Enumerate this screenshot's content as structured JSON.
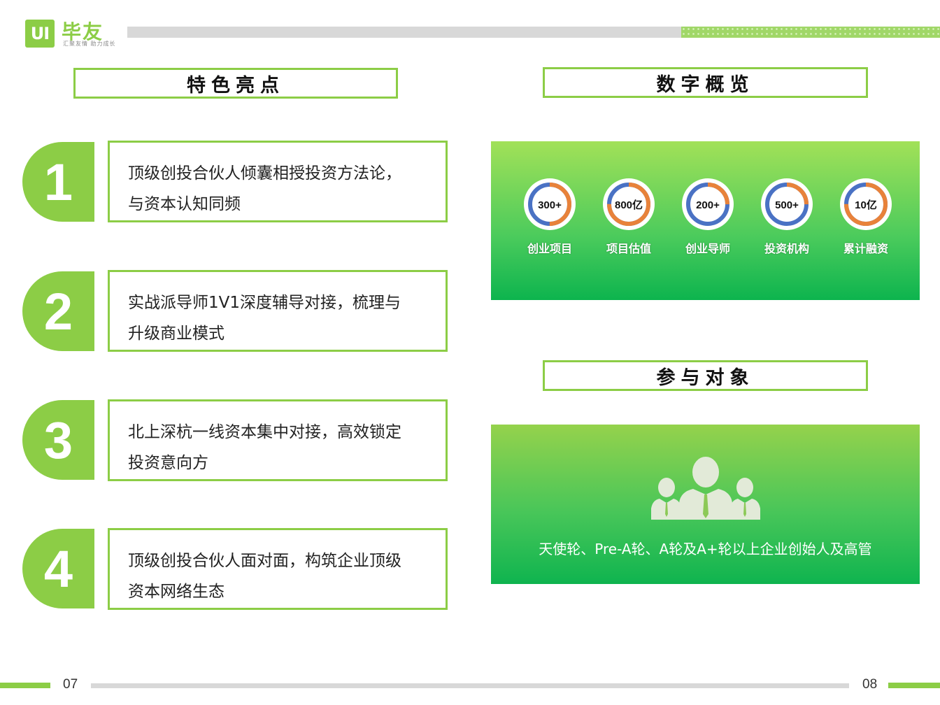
{
  "header": {
    "logo_mark": "UI",
    "logo_name": "毕友",
    "logo_tagline": "汇聚友情 助力成长"
  },
  "sections": {
    "features_title": "特色亮点",
    "stats_title": "数字概览",
    "audience_title": "参与对象"
  },
  "features": [
    {
      "number": "1",
      "line1": "顶级创投合伙人倾囊相授投资方法论，",
      "line2": "与资本认知同频"
    },
    {
      "number": "2",
      "line1": "实战派导师1V1深度辅导对接，梳理与",
      "line2": "升级商业模式"
    },
    {
      "number": "3",
      "line1": "北上深杭一线资本集中对接，高效锁定",
      "line2": "投资意向方"
    },
    {
      "number": "4",
      "line1": "顶级创投合伙人面对面，构筑企业顶级",
      "line2": "资本网络生态"
    }
  ],
  "stats": [
    {
      "value": "300+",
      "label": "创业项目",
      "orange_fraction": 0.5
    },
    {
      "value": "800亿",
      "label": "项目估值",
      "orange_fraction": 0.75
    },
    {
      "value": "200+",
      "label": "创业导师",
      "orange_fraction": 0.25
    },
    {
      "value": "500+",
      "label": "投资机构",
      "orange_fraction": 0.25
    },
    {
      "value": "10亿",
      "label": "累计融资",
      "orange_fraction": 0.75
    }
  ],
  "audience": {
    "icon": "group-people-icon",
    "text": "天使轮、Pre-A轮、A轮及A+轮以上企业创始人及高管"
  },
  "footer": {
    "page_left": "07",
    "page_right": "08"
  },
  "colors": {
    "brand_green": "#8ccd46",
    "ring_orange": "#e8823a",
    "ring_blue": "#4a72c4"
  }
}
